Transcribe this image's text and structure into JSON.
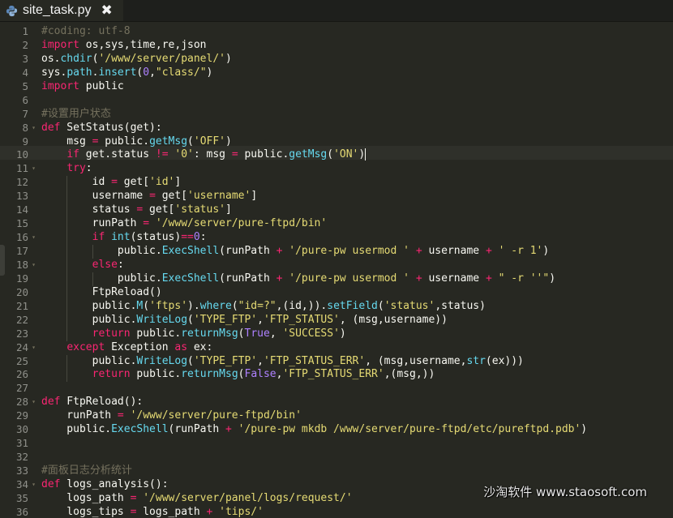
{
  "tab": {
    "title": "site_task.py",
    "close_glyph": "✖",
    "icon": "python-file-icon"
  },
  "colors": {
    "background": "#272822",
    "keyword": "#f92672",
    "string": "#e6db74",
    "function": "#66d9ef",
    "comment": "#75715e",
    "number": "#ae81ff"
  },
  "editor": {
    "current_line": 10,
    "lines": [
      [
        {
          "t": "#coding: utf-8",
          "c": "c"
        }
      ],
      [
        {
          "t": "import",
          "c": "k"
        },
        {
          "t": " os,sys,time,re,json"
        }
      ],
      [
        {
          "t": "os."
        },
        {
          "t": "chdir",
          "c": "f"
        },
        {
          "t": "("
        },
        {
          "t": "'/www/server/panel/'",
          "c": "s"
        },
        {
          "t": ")"
        }
      ],
      [
        {
          "t": "sys."
        },
        {
          "t": "path",
          "c": "f"
        },
        {
          "t": "."
        },
        {
          "t": "insert",
          "c": "f"
        },
        {
          "t": "("
        },
        {
          "t": "0",
          "c": "nu"
        },
        {
          "t": ","
        },
        {
          "t": "\"class/\"",
          "c": "s"
        },
        {
          "t": ")"
        }
      ],
      [
        {
          "t": "import",
          "c": "k"
        },
        {
          "t": " public"
        }
      ],
      [],
      [
        {
          "t": "#设置用户状态",
          "c": "c"
        }
      ],
      [
        {
          "t": "def",
          "c": "k"
        },
        {
          "t": " SetStatus(get):"
        }
      ],
      [
        {
          "t": "    msg "
        },
        {
          "t": "=",
          "c": "k"
        },
        {
          "t": " public."
        },
        {
          "t": "getMsg",
          "c": "f"
        },
        {
          "t": "("
        },
        {
          "t": "'OFF'",
          "c": "s"
        },
        {
          "t": ")"
        }
      ],
      [
        {
          "t": "    "
        },
        {
          "t": "if",
          "c": "k"
        },
        {
          "t": " get.status "
        },
        {
          "t": "!=",
          "c": "k"
        },
        {
          "t": " "
        },
        {
          "t": "'0'",
          "c": "s"
        },
        {
          "t": ": msg "
        },
        {
          "t": "=",
          "c": "k"
        },
        {
          "t": " public."
        },
        {
          "t": "getMsg",
          "c": "f"
        },
        {
          "t": "("
        },
        {
          "t": "'ON'",
          "c": "s"
        },
        {
          "t": ")"
        }
      ],
      [
        {
          "t": "    "
        },
        {
          "t": "try",
          "c": "k"
        },
        {
          "t": ":"
        }
      ],
      [
        {
          "t": "        id "
        },
        {
          "t": "=",
          "c": "k"
        },
        {
          "t": " get["
        },
        {
          "t": "'id'",
          "c": "s"
        },
        {
          "t": "]"
        }
      ],
      [
        {
          "t": "        username "
        },
        {
          "t": "=",
          "c": "k"
        },
        {
          "t": " get["
        },
        {
          "t": "'username'",
          "c": "s"
        },
        {
          "t": "]"
        }
      ],
      [
        {
          "t": "        status "
        },
        {
          "t": "=",
          "c": "k"
        },
        {
          "t": " get["
        },
        {
          "t": "'status'",
          "c": "s"
        },
        {
          "t": "]"
        }
      ],
      [
        {
          "t": "        runPath "
        },
        {
          "t": "=",
          "c": "k"
        },
        {
          "t": " "
        },
        {
          "t": "'/www/server/pure-ftpd/bin'",
          "c": "s"
        }
      ],
      [
        {
          "t": "        "
        },
        {
          "t": "if",
          "c": "k"
        },
        {
          "t": " "
        },
        {
          "t": "int",
          "c": "f"
        },
        {
          "t": "(status)"
        },
        {
          "t": "==",
          "c": "k"
        },
        {
          "t": "0",
          "c": "nu"
        },
        {
          "t": ":"
        }
      ],
      [
        {
          "t": "            public."
        },
        {
          "t": "ExecShell",
          "c": "f"
        },
        {
          "t": "(runPath "
        },
        {
          "t": "+",
          "c": "k"
        },
        {
          "t": " "
        },
        {
          "t": "'/pure-pw usermod '",
          "c": "s"
        },
        {
          "t": " "
        },
        {
          "t": "+",
          "c": "k"
        },
        {
          "t": " username "
        },
        {
          "t": "+",
          "c": "k"
        },
        {
          "t": " "
        },
        {
          "t": "' -r 1'",
          "c": "s"
        },
        {
          "t": ")"
        }
      ],
      [
        {
          "t": "        "
        },
        {
          "t": "else",
          "c": "k"
        },
        {
          "t": ":"
        }
      ],
      [
        {
          "t": "            public."
        },
        {
          "t": "ExecShell",
          "c": "f"
        },
        {
          "t": "(runPath "
        },
        {
          "t": "+",
          "c": "k"
        },
        {
          "t": " "
        },
        {
          "t": "'/pure-pw usermod '",
          "c": "s"
        },
        {
          "t": " "
        },
        {
          "t": "+",
          "c": "k"
        },
        {
          "t": " username "
        },
        {
          "t": "+",
          "c": "k"
        },
        {
          "t": " "
        },
        {
          "t": "\" -r ''\"",
          "c": "s"
        },
        {
          "t": ")"
        }
      ],
      [
        {
          "t": "        FtpReload()"
        }
      ],
      [
        {
          "t": "        public."
        },
        {
          "t": "M",
          "c": "f"
        },
        {
          "t": "("
        },
        {
          "t": "'ftps'",
          "c": "s"
        },
        {
          "t": ")."
        },
        {
          "t": "where",
          "c": "f"
        },
        {
          "t": "("
        },
        {
          "t": "\"id=?\"",
          "c": "s"
        },
        {
          "t": ",(id,))."
        },
        {
          "t": "setField",
          "c": "f"
        },
        {
          "t": "("
        },
        {
          "t": "'status'",
          "c": "s"
        },
        {
          "t": ",status)"
        }
      ],
      [
        {
          "t": "        public."
        },
        {
          "t": "WriteLog",
          "c": "f"
        },
        {
          "t": "("
        },
        {
          "t": "'TYPE_FTP'",
          "c": "s"
        },
        {
          "t": ","
        },
        {
          "t": "'FTP_STATUS'",
          "c": "s"
        },
        {
          "t": ", (msg,username))"
        }
      ],
      [
        {
          "t": "        "
        },
        {
          "t": "return",
          "c": "k"
        },
        {
          "t": " public."
        },
        {
          "t": "returnMsg",
          "c": "f"
        },
        {
          "t": "("
        },
        {
          "t": "True",
          "c": "nu"
        },
        {
          "t": ", "
        },
        {
          "t": "'SUCCESS'",
          "c": "s"
        },
        {
          "t": ")"
        }
      ],
      [
        {
          "t": "    "
        },
        {
          "t": "except",
          "c": "k"
        },
        {
          "t": " Exception "
        },
        {
          "t": "as",
          "c": "k"
        },
        {
          "t": " ex:"
        }
      ],
      [
        {
          "t": "        public."
        },
        {
          "t": "WriteLog",
          "c": "f"
        },
        {
          "t": "("
        },
        {
          "t": "'TYPE_FTP'",
          "c": "s"
        },
        {
          "t": ","
        },
        {
          "t": "'FTP_STATUS_ERR'",
          "c": "s"
        },
        {
          "t": ", (msg,username,"
        },
        {
          "t": "str",
          "c": "f"
        },
        {
          "t": "(ex)))"
        }
      ],
      [
        {
          "t": "        "
        },
        {
          "t": "return",
          "c": "k"
        },
        {
          "t": " public."
        },
        {
          "t": "returnMsg",
          "c": "f"
        },
        {
          "t": "("
        },
        {
          "t": "False",
          "c": "nu"
        },
        {
          "t": ","
        },
        {
          "t": "'FTP_STATUS_ERR'",
          "c": "s"
        },
        {
          "t": ",(msg,))"
        }
      ],
      [],
      [
        {
          "t": "def",
          "c": "k"
        },
        {
          "t": " FtpReload():"
        }
      ],
      [
        {
          "t": "    runPath "
        },
        {
          "t": "=",
          "c": "k"
        },
        {
          "t": " "
        },
        {
          "t": "'/www/server/pure-ftpd/bin'",
          "c": "s"
        }
      ],
      [
        {
          "t": "    public."
        },
        {
          "t": "ExecShell",
          "c": "f"
        },
        {
          "t": "(runPath "
        },
        {
          "t": "+",
          "c": "k"
        },
        {
          "t": " "
        },
        {
          "t": "'/pure-pw mkdb /www/server/pure-ftpd/etc/pureftpd.pdb'",
          "c": "s"
        },
        {
          "t": ")"
        }
      ],
      [],
      [],
      [
        {
          "t": "#面板日志分析统计",
          "c": "c"
        }
      ],
      [
        {
          "t": "def",
          "c": "k"
        },
        {
          "t": " logs_analysis():"
        }
      ],
      [
        {
          "t": "    logs_path "
        },
        {
          "t": "=",
          "c": "k"
        },
        {
          "t": " "
        },
        {
          "t": "'/www/server/panel/logs/request/'",
          "c": "s"
        }
      ],
      [
        {
          "t": "    logs_tips "
        },
        {
          "t": "=",
          "c": "k"
        },
        {
          "t": " logs_path "
        },
        {
          "t": "+",
          "c": "k"
        },
        {
          "t": " "
        },
        {
          "t": "'tips/'",
          "c": "s"
        }
      ]
    ],
    "line_numbers": [
      "1",
      "2",
      "3",
      "4",
      "5",
      "6",
      "7",
      "8",
      "9",
      "10",
      "11",
      "12",
      "13",
      "14",
      "15",
      "16",
      "17",
      "18",
      "19",
      "20",
      "21",
      "22",
      "23",
      "24",
      "25",
      "26",
      "27",
      "28",
      "29",
      "30",
      "31",
      "32",
      "33",
      "34",
      "35",
      "36"
    ],
    "fold_lines": [
      8,
      11,
      16,
      18,
      24,
      28,
      34
    ]
  },
  "watermark": "沙淘软件 www.staosoft.com"
}
